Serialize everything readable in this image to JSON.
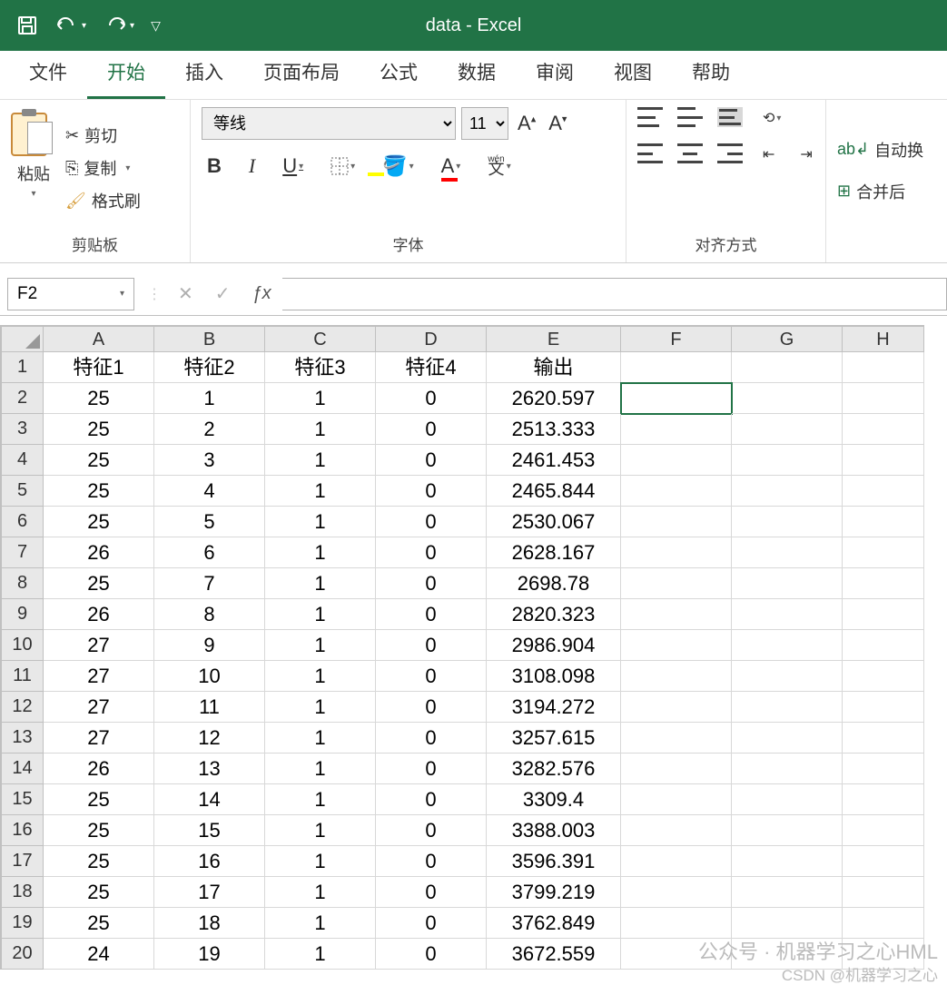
{
  "title": "data  -  Excel",
  "menu": {
    "file": "文件",
    "home": "开始",
    "insert": "插入",
    "layout": "页面布局",
    "formula": "公式",
    "data": "数据",
    "review": "审阅",
    "view": "视图",
    "help": "帮助"
  },
  "ribbon": {
    "clipboard": {
      "label": "剪贴板",
      "paste": "粘贴",
      "cut": "剪切",
      "copy": "复制",
      "painter": "格式刷"
    },
    "font": {
      "label": "字体",
      "name": "等线",
      "size": "11",
      "bold": "B",
      "italic": "I",
      "underline": "U",
      "wen": "文"
    },
    "align": {
      "label": "对齐方式",
      "wrap": "自动换",
      "merge": "合并后"
    }
  },
  "formula_bar": {
    "name_box": "F2",
    "fx": "ƒx",
    "value": ""
  },
  "columns": [
    "A",
    "B",
    "C",
    "D",
    "E",
    "F",
    "G",
    "H"
  ],
  "headers": [
    "特征1",
    "特征2",
    "特征3",
    "特征4",
    "输出"
  ],
  "rows": [
    [
      "25",
      "1",
      "1",
      "0",
      "2620.597"
    ],
    [
      "25",
      "2",
      "1",
      "0",
      "2513.333"
    ],
    [
      "25",
      "3",
      "1",
      "0",
      "2461.453"
    ],
    [
      "25",
      "4",
      "1",
      "0",
      "2465.844"
    ],
    [
      "25",
      "5",
      "1",
      "0",
      "2530.067"
    ],
    [
      "26",
      "6",
      "1",
      "0",
      "2628.167"
    ],
    [
      "25",
      "7",
      "1",
      "0",
      "2698.78"
    ],
    [
      "26",
      "8",
      "1",
      "0",
      "2820.323"
    ],
    [
      "27",
      "9",
      "1",
      "0",
      "2986.904"
    ],
    [
      "27",
      "10",
      "1",
      "0",
      "3108.098"
    ],
    [
      "27",
      "11",
      "1",
      "0",
      "3194.272"
    ],
    [
      "27",
      "12",
      "1",
      "0",
      "3257.615"
    ],
    [
      "26",
      "13",
      "1",
      "0",
      "3282.576"
    ],
    [
      "25",
      "14",
      "1",
      "0",
      "3309.4"
    ],
    [
      "25",
      "15",
      "1",
      "0",
      "3388.003"
    ],
    [
      "25",
      "16",
      "1",
      "0",
      "3596.391"
    ],
    [
      "25",
      "17",
      "1",
      "0",
      "3799.219"
    ],
    [
      "25",
      "18",
      "1",
      "0",
      "3762.849"
    ],
    [
      "24",
      "19",
      "1",
      "0",
      "3672.559"
    ]
  ],
  "selected_cell": "F2",
  "watermark1": "公众号 · 机器学习之心HML",
  "watermark2": "CSDN @机器学习之心"
}
